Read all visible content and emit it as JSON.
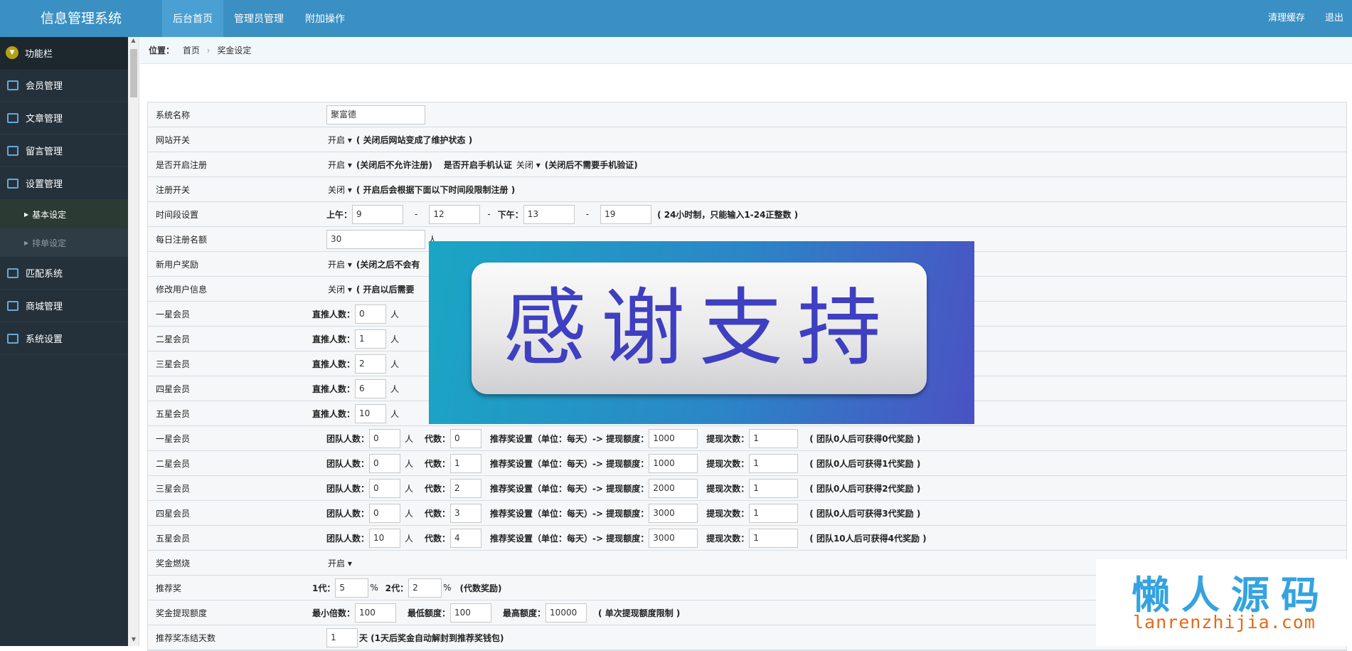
{
  "app": {
    "title": "信息管理系统"
  },
  "topnav": [
    {
      "label": "后台首页"
    },
    {
      "label": "管理员管理"
    },
    {
      "label": "附加操作"
    }
  ],
  "topright": {
    "clear_cache": "清理缓存",
    "logout": "退出"
  },
  "sidebar": {
    "header": "功能栏",
    "items": [
      "会员管理",
      "文章管理",
      "留言管理",
      "设置管理"
    ],
    "subitems": [
      "基本设定",
      "排单设定"
    ],
    "items2": [
      "匹配系统",
      "商城管理",
      "系统设置"
    ]
  },
  "breadcrumb": {
    "label": "位置：",
    "home": "首页",
    "sep": "›",
    "current": "奖金设定"
  },
  "form": {
    "system_name": {
      "label": "系统名称",
      "value": "聚富德"
    },
    "site_switch": {
      "label": "网站开关",
      "value": "开启",
      "note": "( 关闭后网站变成了维护状态 )"
    },
    "register_open": {
      "label": "是否开启注册",
      "value": "开启",
      "note": "(关闭后不允许注册)",
      "label2": "是否开启手机认证",
      "value2": "关闭",
      "note2": "(关闭后不需要手机验证)"
    },
    "register_switch": {
      "label": "注册开关",
      "value": "关闭",
      "note": "( 开启后会根据下面以下时间段限制注册 )"
    },
    "time_period": {
      "label": "时间段设置",
      "am_label": "上午：",
      "am_start": "9",
      "dash": "-",
      "am_end": "12",
      "pm_label": "下午：",
      "pm_start": "13",
      "pm_end": "19",
      "note": "( 24小时制，只能输入1-24正整数 )"
    },
    "daily_quota": {
      "label": "每日注册名额",
      "value": "30",
      "unit": "人"
    },
    "new_user_reward": {
      "label": "新用户奖励",
      "value": "开启",
      "note": "(关闭之后不会有"
    },
    "modify_user": {
      "label": "修改用户信息",
      "value": "关闭",
      "note": "( 开启以后需要"
    },
    "direct_label": "直推人数：",
    "person_unit": "人",
    "direct_levels": [
      {
        "label": "一星会员",
        "value": "0"
      },
      {
        "label": "二星会员",
        "value": "1"
      },
      {
        "label": "三星会员",
        "value": "2"
      },
      {
        "label": "四星会员",
        "value": "6"
      },
      {
        "label": "五星会员",
        "value": "10"
      }
    ],
    "team_label": "团队人数：",
    "gen_label": "代数：",
    "reco_label": "推荐奖设置（单位：每天）-> 提现额度：",
    "times_label": "提现次数：",
    "team_levels": [
      {
        "label": "一星会员",
        "team": "0",
        "gen": "0",
        "amount": "1000",
        "times": "1",
        "note": "( 团队0人后可获得0代奖励 )"
      },
      {
        "label": "二星会员",
        "team": "0",
        "gen": "1",
        "amount": "1000",
        "times": "1",
        "note": "( 团队0人后可获得1代奖励 )"
      },
      {
        "label": "三星会员",
        "team": "0",
        "gen": "2",
        "amount": "2000",
        "times": "1",
        "note": "( 团队0人后可获得2代奖励 )"
      },
      {
        "label": "四星会员",
        "team": "0",
        "gen": "3",
        "amount": "3000",
        "times": "1",
        "note": "( 团队0人后可获得3代奖励 )"
      },
      {
        "label": "五星会员",
        "team": "10",
        "gen": "4",
        "amount": "3000",
        "times": "1",
        "note": "( 团队10人后可获得4代奖励 )"
      }
    ],
    "bonus_burn": {
      "label": "奖金燃烧",
      "value": "开启"
    },
    "referral": {
      "label": "推荐奖",
      "g1_label": "1代：",
      "g1": "5",
      "g2_label": "2代：",
      "g2": "2",
      "pct": "%",
      "note": "(代数奖励)"
    },
    "withdraw": {
      "label": "奖金提现额度",
      "min_mult_label": "最小倍数：",
      "min_mult": "100",
      "min_label": "最低额度：",
      "min": "100",
      "max_label": "最高额度：",
      "max": "10000",
      "note": "( 单次提现额度限制 )"
    },
    "freeze": {
      "label": "推荐奖冻结天数",
      "value": "1",
      "note": "天 (1天后奖金自动解封到推荐奖钱包)"
    }
  },
  "overlay": {
    "text": "感谢支持"
  },
  "watermark": {
    "title": "懒人源码",
    "url": "lanrenzhijia.com"
  }
}
